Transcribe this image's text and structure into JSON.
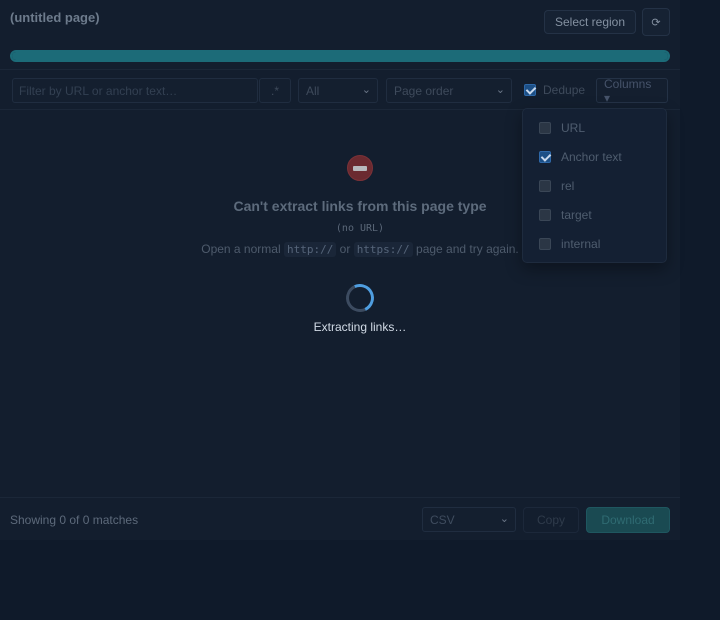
{
  "header": {
    "title": "(untitled page)",
    "select_region_label": "Select region",
    "refresh_icon": "refresh-icon",
    "refresh_glyph": "⟳"
  },
  "progress": {
    "value_percent": 100
  },
  "toolbar": {
    "filter_placeholder": "Filter by URL or anchor text…",
    "regex_label": ".*",
    "type_select_value": "All",
    "order_select_value": "Page order",
    "dedupe_label": "Dedupe",
    "dedupe_checked": true,
    "columns_label": "Columns ▾"
  },
  "empty_state": {
    "icon": "no-entry-icon",
    "title": "Can't extract links from this page type",
    "subtitle": "(no URL)",
    "hint_prefix": "Open a normal",
    "hint_code_1": "http://",
    "hint_or": "or",
    "hint_code_2": "https://",
    "hint_suffix": "page and try again."
  },
  "loading": {
    "text": "Extracting links…"
  },
  "footer": {
    "match_count": "Showing 0 of 0 matches",
    "format_select_value": "CSV",
    "copy_label": "Copy",
    "download_label": "Download"
  },
  "columns_menu": {
    "items": [
      {
        "label": "URL",
        "checked": false
      },
      {
        "label": "Anchor text",
        "checked": true
      },
      {
        "label": "rel",
        "checked": false
      },
      {
        "label": "target",
        "checked": false
      },
      {
        "label": "internal",
        "checked": false
      }
    ]
  },
  "colors": {
    "background": "#0f1a2a",
    "accent_teal": "#1c6b78",
    "spinner_blue": "#4f9ee0",
    "download_button": "#1a4a52",
    "error_icon": "#6b2a30"
  }
}
